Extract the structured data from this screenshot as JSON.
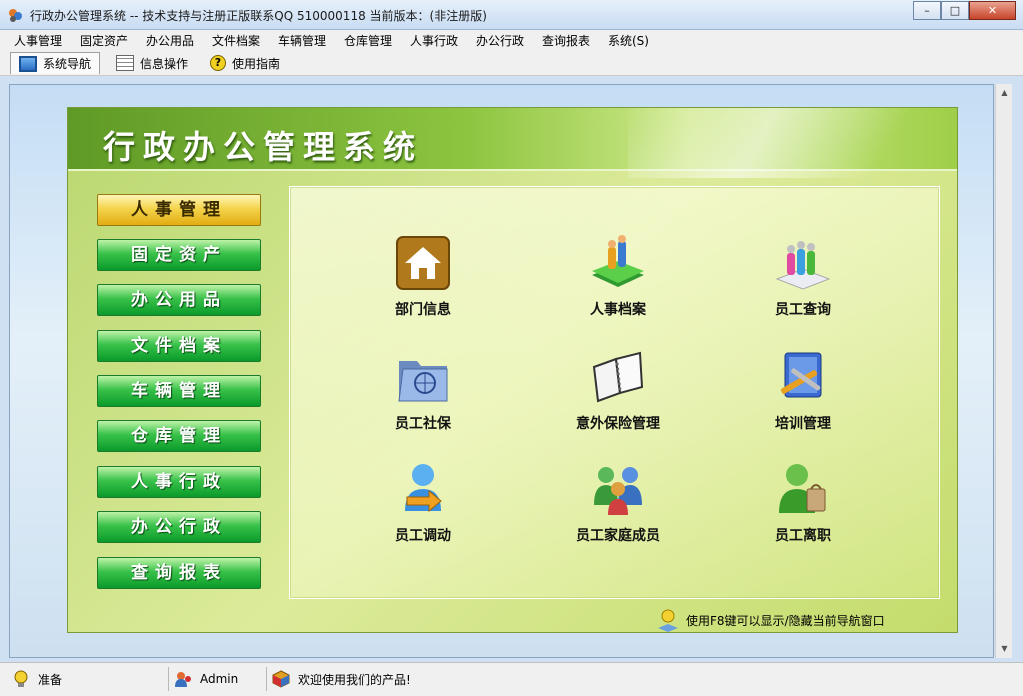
{
  "window": {
    "title": "行政办公管理系统 -- 技术支持与注册正版联系QQ 510000118    当前版本：(非注册版)",
    "controls": {
      "minimize": "–",
      "maximize": "□",
      "close": "✕"
    }
  },
  "menu": [
    "人事管理",
    "固定资产",
    "办公用品",
    "文件档案",
    "车辆管理",
    "仓库管理",
    "人事行政",
    "办公行政",
    "查询报表",
    "系统(S)"
  ],
  "toolbar": {
    "tabs": [
      {
        "label": "系统导航",
        "icon": "nav-window-icon",
        "active": true
      },
      {
        "label": "信息操作",
        "icon": "grid-icon",
        "active": false
      },
      {
        "label": "使用指南",
        "icon": "help-icon",
        "active": false
      }
    ]
  },
  "scrollbar": {
    "up": "▲",
    "down": "▼"
  },
  "panel": {
    "banner_title": "行政办公管理系统",
    "sidebar": [
      "人事管理",
      "固定资产",
      "办公用品",
      "文件档案",
      "车辆管理",
      "仓库管理",
      "人事行政",
      "办公行政",
      "查询报表"
    ],
    "selected_sidebar": "人事管理",
    "modules": [
      {
        "label": "部门信息",
        "icon": "home-icon"
      },
      {
        "label": "人事档案",
        "icon": "staff-book-icon"
      },
      {
        "label": "员工查询",
        "icon": "people-search-icon"
      },
      {
        "label": "员工社保",
        "icon": "folder-globe-icon"
      },
      {
        "label": "意外保险管理",
        "icon": "notebook-icon"
      },
      {
        "label": "培训管理",
        "icon": "book-tools-icon"
      },
      {
        "label": "员工调动",
        "icon": "user-transfer-icon"
      },
      {
        "label": "员工家庭成员",
        "icon": "family-icon"
      },
      {
        "label": "员工离职",
        "icon": "user-leave-icon"
      }
    ],
    "hint": "使用F8键可以显示/隐藏当前导航窗口"
  },
  "status": {
    "state": "准备",
    "user": "Admin",
    "message": "欢迎使用我们的产品!"
  },
  "colors": {
    "accent_green": "#39c24a",
    "selected_gold": "#f4d44c",
    "banner_green": "#8dc540"
  }
}
